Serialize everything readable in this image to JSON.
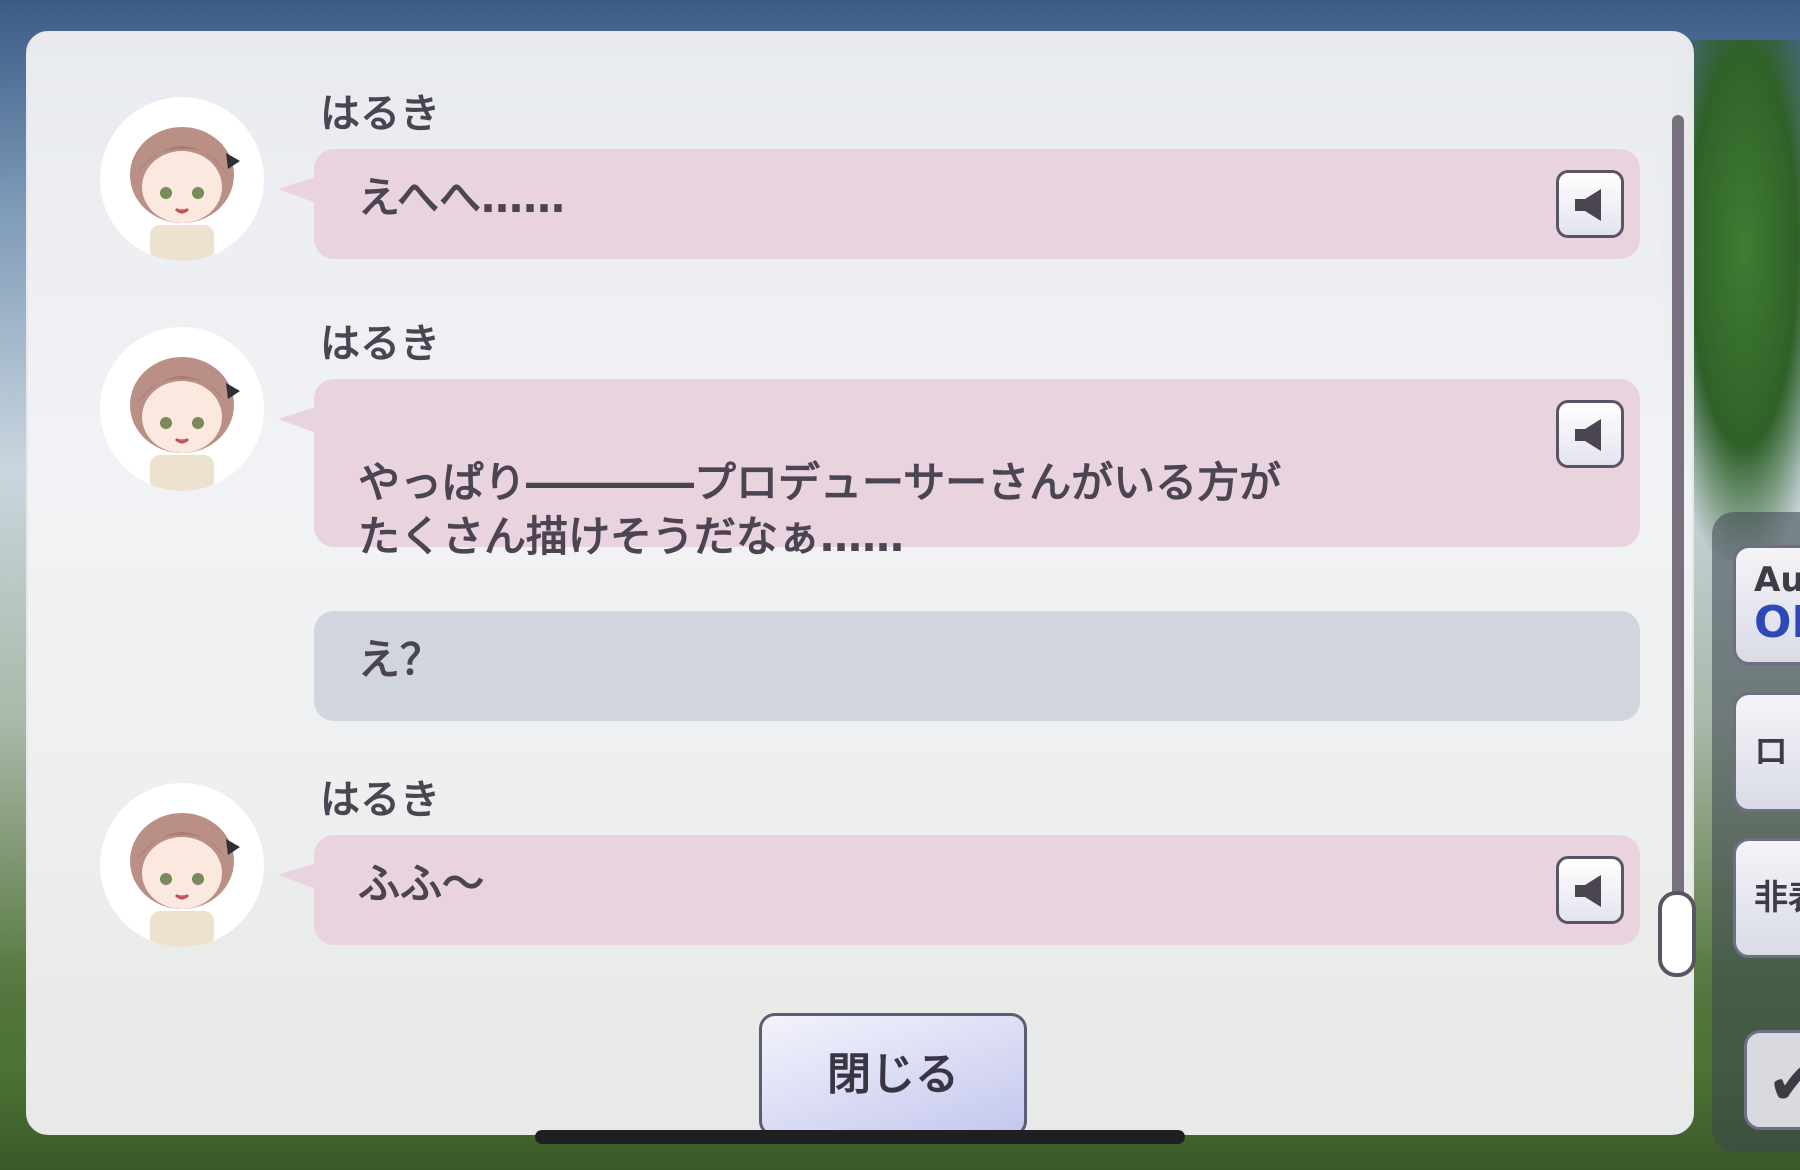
{
  "log": {
    "entries": [
      {
        "speaker": "はるき",
        "text": "えへへ……",
        "voice": true
      },
      {
        "speaker": "はるき",
        "text": "やっぱり――――プロデューサーさんがいる方が\nたくさん描けそうだなぁ……",
        "voice": true
      },
      {
        "speaker": "",
        "text": "え？",
        "voice": false
      },
      {
        "speaker": "はるき",
        "text": "ふふ～",
        "voice": true
      }
    ],
    "close_label": "閉じる"
  },
  "side_menu": {
    "auto_label": "Au",
    "auto_state": "OF",
    "log_label": "ロ",
    "hide_label": "非表"
  },
  "colors": {
    "bubble_character": "#e8d3de",
    "bubble_narration": "#d1d5dd",
    "text": "#4b4452",
    "auto_accent": "#2f48b7"
  }
}
